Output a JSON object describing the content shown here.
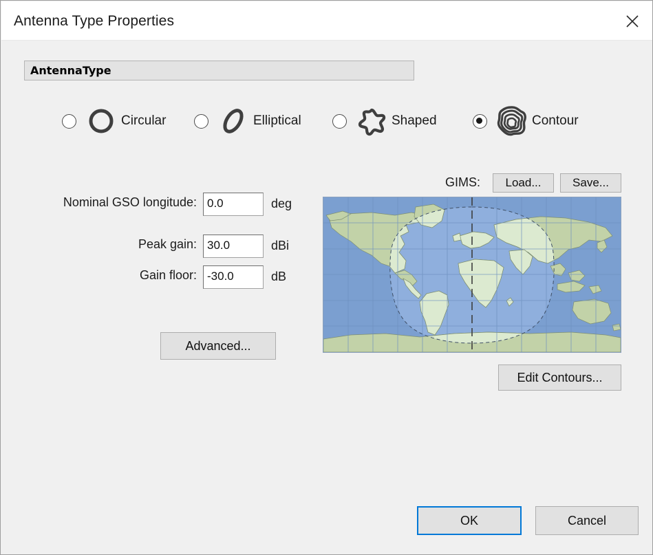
{
  "window": {
    "title": "Antenna Type Properties",
    "close_icon": "close-icon"
  },
  "group": {
    "header_label": "AntennaType"
  },
  "antenna_types": {
    "selected": "Contour",
    "options": [
      {
        "label": "Circular",
        "icon": "circle-outline-icon",
        "selected": false
      },
      {
        "label": "Elliptical",
        "icon": "ellipse-outline-icon",
        "selected": false
      },
      {
        "label": "Shaped",
        "icon": "blob-star-outline-icon",
        "selected": false
      },
      {
        "label": "Contour",
        "icon": "contour-rings-icon",
        "selected": true
      }
    ]
  },
  "fields": [
    {
      "label": "Nominal GSO longitude:",
      "value": "0.0",
      "unit": "deg",
      "placeholder": ""
    },
    {
      "label": "Peak gain:",
      "value": "30.0",
      "unit": "dBi",
      "placeholder": ""
    },
    {
      "label": "Gain floor:",
      "value": "-30.0",
      "unit": "dB",
      "placeholder": ""
    }
  ],
  "buttons": {
    "advanced": "Advanced...",
    "edit_contours": "Edit Contours...",
    "ok": "OK",
    "cancel": "Cancel"
  },
  "gims": {
    "label": "GIMS:",
    "load": "Load...",
    "save": "Save..."
  },
  "map": {
    "ocean_color": "#7b9fd0",
    "land_color": "#c2d2a8",
    "land_color_inside": "#dcead0",
    "coverage_fill": "#8fb0e0",
    "grid_color": "#6d8fbe",
    "meridian_color": "#3d3d3d"
  },
  "colors": {
    "accent": "#0078d7",
    "dialog_bg": "#f0f0f0",
    "titlebar_bg": "#ffffff",
    "button_bg": "#e1e1e1",
    "icon_stroke": "#3f3f3f"
  }
}
